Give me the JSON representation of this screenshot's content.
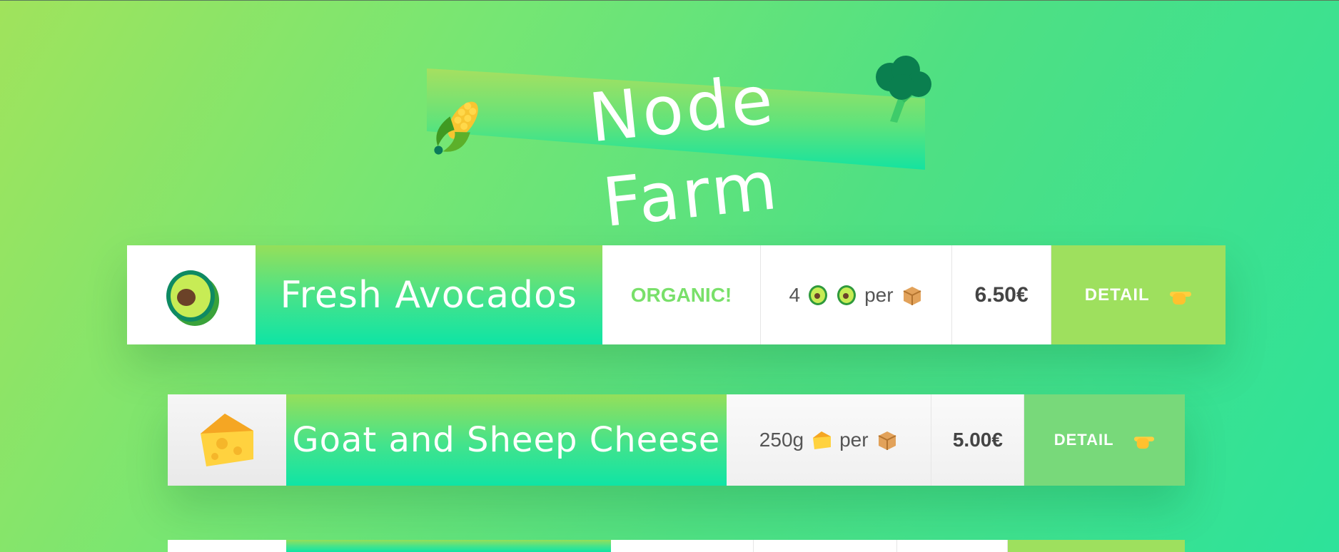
{
  "header": {
    "title": "Node Farm",
    "icons": [
      "corn-icon",
      "broccoli-icon"
    ]
  },
  "cards": [
    {
      "name": "Fresh Avocados",
      "badge": "ORGANIC!",
      "quantity": "4",
      "per": "per",
      "price": "6.50€",
      "detail": "DETAIL",
      "icons": [
        "avocado-icon",
        "box-icon",
        "pointing-hand-icon"
      ]
    },
    {
      "name": "Goat and Sheep Cheese",
      "quantity": "250g",
      "per": "per",
      "price": "5.00€",
      "detail": "DETAIL",
      "icons": [
        "cheese-icon",
        "box-icon",
        "pointing-hand-icon"
      ]
    }
  ],
  "colors": {
    "accent_green": "#9ee05e",
    "name_gradient_bottom": "#0fe4a5",
    "organic_text": "#79e06a",
    "detail_bg_card2": "#78d97a"
  }
}
